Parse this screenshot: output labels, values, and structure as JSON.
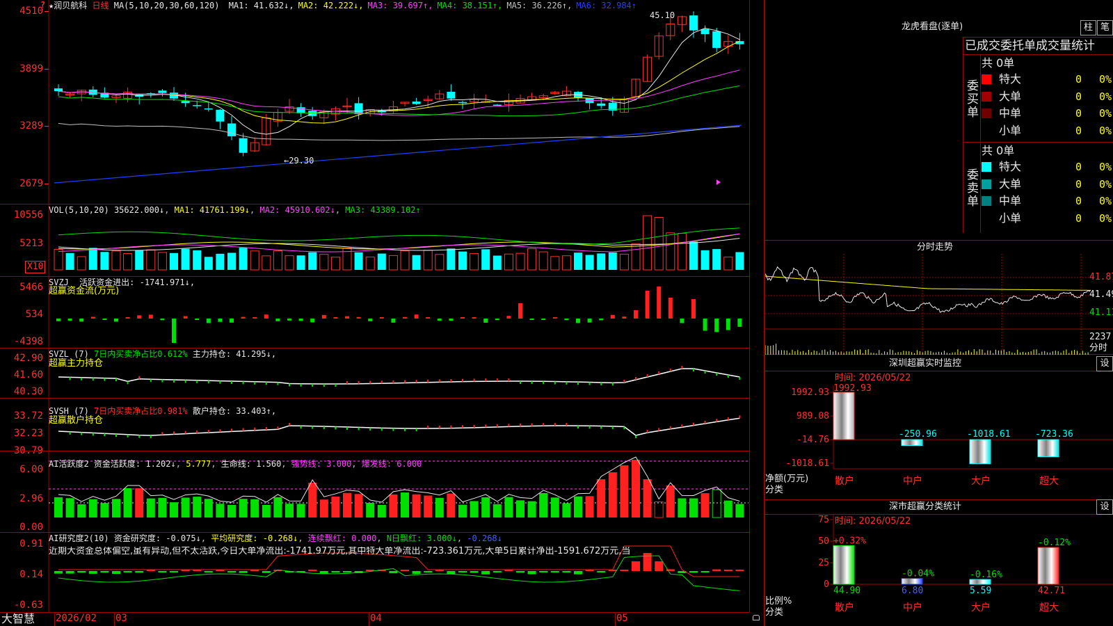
{
  "stock": {
    "name": "润贝航科",
    "period": "日线"
  },
  "main_chart": {
    "ma_header": "MA(5,10,20,30,60,120)",
    "ma": [
      {
        "label": "MA1: 41.632",
        "arrow": "↓",
        "color": "#e8e8e8"
      },
      {
        "label": "MA2: 42.222",
        "arrow": "↓",
        "color": "#ffff00"
      },
      {
        "label": "MA3: 39.697",
        "arrow": "↑",
        "color": "#ff40ff"
      },
      {
        "label": "MA4: 38.151",
        "arrow": "↑",
        "color": "#00e000"
      },
      {
        "label": "MA5: 36.226",
        "arrow": "↑",
        "color": "#c0c0c0"
      },
      {
        "label": "MA6: 32.984",
        "arrow": "↑",
        "color": "#2040ff"
      }
    ],
    "y_ticks": [
      "4510",
      "3899",
      "3289",
      "2679"
    ],
    "high_label": "45.10",
    "low_label": "←29.30",
    "corner_mark": "?"
  },
  "volume": {
    "header": "VOL(5,10,20)",
    "value": "35622.000↓",
    "ma1": "MA1: 41761.199↓",
    "ma2": "MA2: 45910.602↓",
    "ma3": "MA3: 43389.102↑",
    "y_ticks": [
      "10556",
      "5213"
    ],
    "unit": "X10"
  },
  "svzj": {
    "header": "SVZJ",
    "line1": "活跃资金进出: -1741.971↓,",
    "line2": "超赢资金流(万元)",
    "y_ticks": [
      "5466",
      "534",
      "-4398"
    ]
  },
  "svzl": {
    "header": "SVZL (7)",
    "ratio": "7日内买卖净占比0.612%",
    "hold": "主力持仓: 41.295↓,",
    "line2": "超赢主力持仓",
    "y_ticks": [
      "42.90",
      "41.60",
      "40.30"
    ]
  },
  "svsh": {
    "header": "SVSH (7)",
    "ratio": "7日内买卖净占比0.981%",
    "hold": "散户持仓: 33.403↑,",
    "line2": "超赢散户持仓",
    "y_ticks": [
      "33.72",
      "32.23",
      "30.79"
    ]
  },
  "ai_active": {
    "header": "AI活跃度2",
    "a": "资金活跃度: 1.202↓",
    "b": "5.777",
    "c": "生命线: 1.560",
    "d": "强势线: 3.000",
    "e": "爆发线: 6.000",
    "y_ticks": [
      "6.00",
      "2.96",
      "0.00"
    ]
  },
  "ai_research": {
    "header": "AI研究度2(10)",
    "a": "资金研究度: -0.075↓",
    "b": "平均研究度: -0.268↓",
    "c": "连续飘红: 0.000",
    "d": "N日飘红: 3.000↓",
    "e": "-0.268↓",
    "summary": "近期大资金总体偏空,虽有异动,但不太活跃,今日大单净流出:-1741.97万元,其中特大单净流出:-723.361万元,大单5日累计净出-1591.672万元,当",
    "y_ticks": [
      "0.91",
      "0.14",
      "-0.63"
    ]
  },
  "x_axis": {
    "labels": [
      "2026/02",
      "03",
      "04",
      "05"
    ],
    "brand": "大智慧"
  },
  "right": {
    "dragon_title": "龙虎看盘(逐单)",
    "btn_zhu": "柱",
    "btn_bi": "笔",
    "tabs": [
      "已成交",
      "委托单",
      "成交量统计"
    ],
    "buy": {
      "side_label": "委买单",
      "total": "共 0单",
      "rows": [
        {
          "label": "特大",
          "count": "0",
          "pct": "0%",
          "color": "#ff0000"
        },
        {
          "label": "大单",
          "count": "0",
          "pct": "0%",
          "color": "#a00000"
        },
        {
          "label": "中单",
          "count": "0",
          "pct": "0%",
          "color": "#700000"
        },
        {
          "label": "小单",
          "count": "0",
          "pct": "0%",
          "color": "#000000"
        }
      ]
    },
    "sell": {
      "side_label": "委卖单",
      "total": "共 0单",
      "rows": [
        {
          "label": "特大",
          "count": "0",
          "pct": "0%",
          "color": "#00ffff"
        },
        {
          "label": "大单",
          "count": "0",
          "pct": "0%",
          "color": "#00a0a0"
        },
        {
          "label": "中单",
          "count": "0",
          "pct": "0%",
          "color": "#008080"
        },
        {
          "label": "小单",
          "count": "0",
          "pct": "0%",
          "color": "#000000"
        }
      ]
    },
    "intraday": {
      "title": "分时走势",
      "prices": [
        "41.87",
        "41.49",
        "41.11"
      ],
      "volume_label": "2237",
      "volume_caption": "分时"
    },
    "monitor": {
      "title": "深圳超赢实时监控",
      "btn": "设",
      "time": "时间: 2026/05/22",
      "y_ticks": [
        "1992.93",
        "989.08",
        "-14.76",
        "-1018.61"
      ],
      "y_caption": "净额(万元)",
      "x_caption": "分类",
      "categories": [
        "散户",
        "中户",
        "大户",
        "超大"
      ],
      "values": [
        1992.93,
        -250.96,
        -1018.61,
        -723.36
      ],
      "value_labels": [
        "1992.93",
        "-250.96",
        "-1018.61",
        "-723.36"
      ]
    },
    "stats": {
      "title": "深市超赢分类统计",
      "btn": "设",
      "time": "时间: 2026/05/22",
      "y_ticks": [
        "75",
        "50",
        "25",
        "0"
      ],
      "y_caption": "比例%",
      "x_caption": "分类",
      "categories": [
        "散户",
        "中户",
        "大户",
        "超大"
      ],
      "values": [
        44.9,
        6.8,
        5.59,
        42.71
      ],
      "value_labels": [
        "44.90",
        "6.80",
        "5.59",
        "42.71"
      ],
      "change_labels": [
        "+0.32%",
        "-0.04%",
        "-0.16%",
        "-0.12%"
      ]
    }
  }
}
